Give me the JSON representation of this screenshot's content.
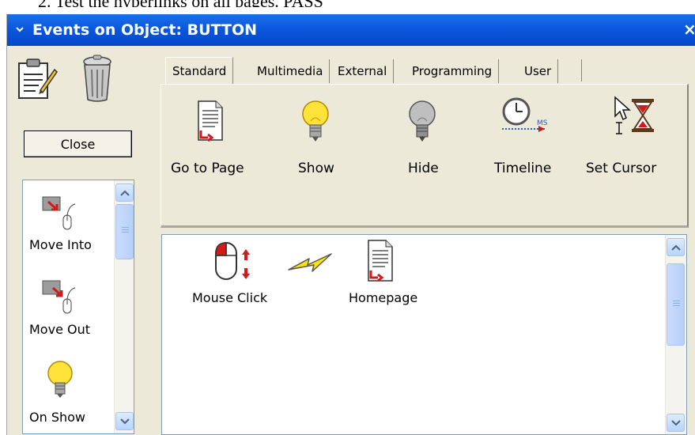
{
  "document": {
    "cutoff_line": "2.    Test the hyperlinks on all pages. PASS"
  },
  "window": {
    "title": "Events on Object: BUTTON",
    "close_glyph": "×"
  },
  "left_panel": {
    "close_button": "Close",
    "events": [
      {
        "label": "Move Into",
        "icon": "move-into-icon"
      },
      {
        "label": "Move Out",
        "icon": "move-out-icon"
      },
      {
        "label": "On Show",
        "icon": "lightbulb-on-icon"
      }
    ]
  },
  "tabs": [
    {
      "label": "Standard",
      "active": true
    },
    {
      "label": "Multimedia",
      "active": false
    },
    {
      "label": "External",
      "active": false
    },
    {
      "label": "Programming",
      "active": false
    },
    {
      "label": "User",
      "active": false
    }
  ],
  "actions": [
    {
      "label": "Go to Page",
      "icon": "page-link-icon"
    },
    {
      "label": "Show",
      "icon": "lightbulb-on-icon"
    },
    {
      "label": "Hide",
      "icon": "lightbulb-off-icon"
    },
    {
      "label": "Timeline",
      "icon": "clock-timeline-icon"
    },
    {
      "label": "Set Cursor",
      "icon": "cursor-hourglass-icon"
    }
  ],
  "event_canvas": {
    "trigger_label": "Mouse Click",
    "trigger_icon": "mouse-click-icon",
    "connector_icon": "lightning-bolt-icon",
    "target_label": "Homepage",
    "target_icon": "page-link-icon"
  },
  "colors": {
    "titlebar": "#0b58de",
    "dialog_bg": "#ece9d8",
    "scrollbar_accent": "#b7d4fb"
  }
}
